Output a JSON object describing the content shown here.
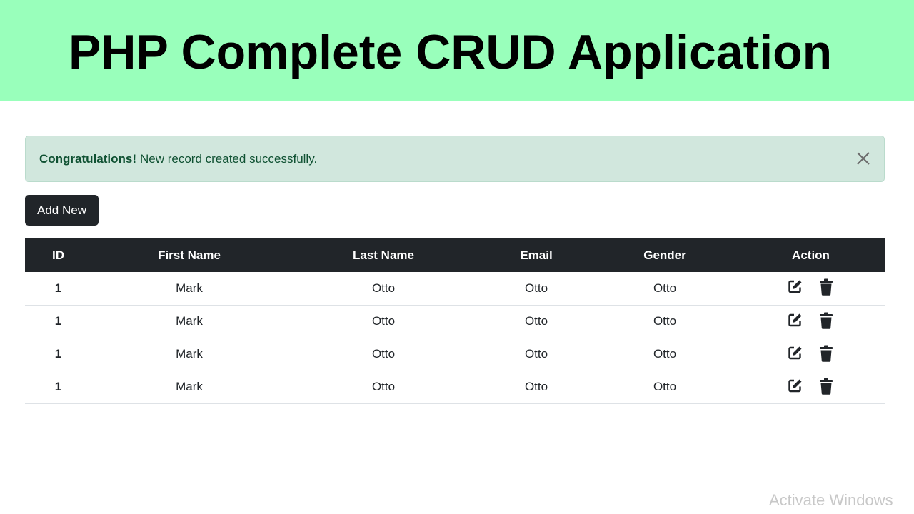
{
  "banner": {
    "title": "PHP Complete CRUD Application",
    "background": "#99ffbb"
  },
  "alert": {
    "strong": "Congratulations!",
    "message": "New record created successfully.",
    "close_icon": "close-icon",
    "background": "#d1e7dd",
    "text_color": "#0f5132"
  },
  "toolbar": {
    "add_label": "Add New"
  },
  "table": {
    "headers": [
      "ID",
      "First Name",
      "Last Name",
      "Email",
      "Gender",
      "Action"
    ],
    "rows": [
      {
        "id": "1",
        "first": "Mark",
        "last": "Otto",
        "email": "Otto",
        "gender": "Otto"
      },
      {
        "id": "1",
        "first": "Mark",
        "last": "Otto",
        "email": "Otto",
        "gender": "Otto"
      },
      {
        "id": "1",
        "first": "Mark",
        "last": "Otto",
        "email": "Otto",
        "gender": "Otto"
      },
      {
        "id": "1",
        "first": "Mark",
        "last": "Otto",
        "email": "Otto",
        "gender": "Otto"
      }
    ],
    "action_icons": [
      "edit-icon",
      "trash-icon"
    ],
    "header_background": "#212529"
  },
  "watermark": {
    "text": "Activate Windows"
  }
}
